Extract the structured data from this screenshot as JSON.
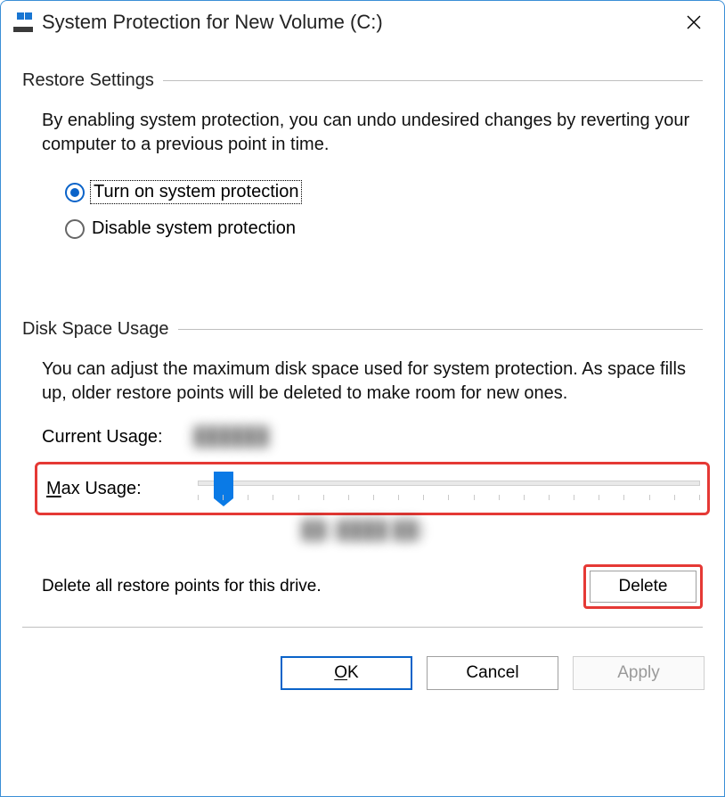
{
  "window": {
    "title": "System Protection for New Volume (C:)"
  },
  "restore": {
    "section_label": "Restore Settings",
    "description": "By enabling system protection, you can undo undesired changes by reverting your computer to a previous point in time.",
    "option_on": "Turn on system protection",
    "option_off": "Disable system protection",
    "selected": "on"
  },
  "disk": {
    "section_label": "Disk Space Usage",
    "description": "You can adjust the maximum disk space used for system protection. As space fills up, older restore points will be deleted to make room for new ones.",
    "current_usage_label": "Current Usage:",
    "current_usage_value": "██████",
    "max_usage_label_prefix": "M",
    "max_usage_label_rest": "ax Usage:",
    "slider_value_display": "██ (████ ██)",
    "delete_description": "Delete all restore points for this drive.",
    "delete_button": "Delete"
  },
  "footer": {
    "ok_underline": "O",
    "ok_rest": "K",
    "cancel": "Cancel",
    "apply": "Apply"
  }
}
